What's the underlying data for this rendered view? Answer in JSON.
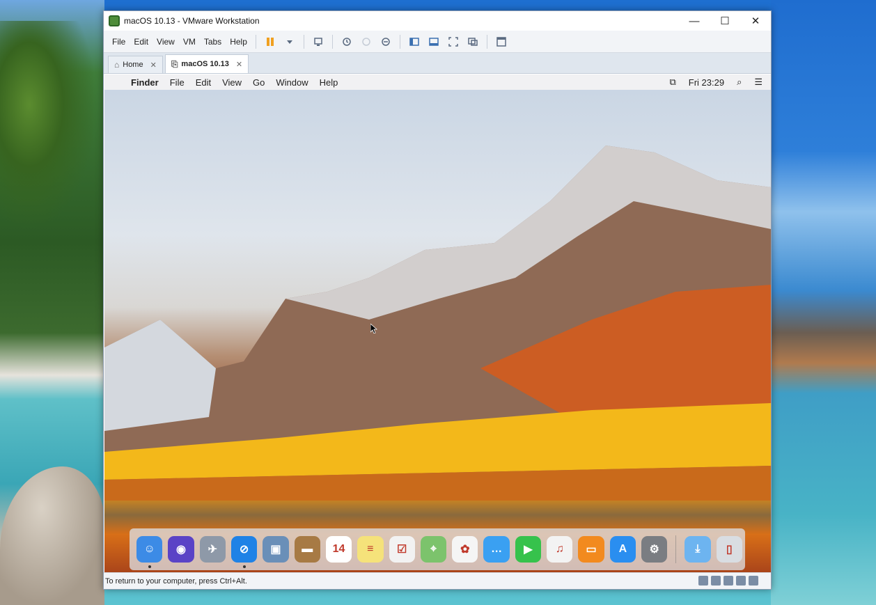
{
  "window": {
    "title": "macOS 10.13 - VMware Workstation",
    "minimize": "—",
    "maximize": "☐",
    "close": "✕"
  },
  "menubar": {
    "items": [
      "File",
      "Edit",
      "View",
      "VM",
      "Tabs",
      "Help"
    ]
  },
  "toolbar": {
    "buttons": [
      "pause-icon",
      "dropdown-icon",
      "send-ctrl-alt-del-icon",
      "snapshot-icon",
      "revert-snapshot-icon",
      "snapshot-manager-icon",
      "show-library-icon",
      "thumbnail-bar-icon",
      "full-screen-icon",
      "unity-icon",
      "console-view-icon"
    ]
  },
  "tabs": [
    {
      "label": "Home",
      "icon": "home-icon",
      "close": "✕"
    },
    {
      "label": "macOS 10.13",
      "icon": "vm-icon",
      "close": "✕",
      "active": true
    }
  ],
  "guest_menubar": {
    "apple": "",
    "items": [
      "Finder",
      "File",
      "Edit",
      "View",
      "Go",
      "Window",
      "Help"
    ],
    "clock": "Fri 23:29"
  },
  "dock": {
    "apps": [
      {
        "name": "finder",
        "color": "#3c8be6",
        "glyph": "☺",
        "running": true
      },
      {
        "name": "siri",
        "color": "#5a43c6",
        "glyph": "◉"
      },
      {
        "name": "launchpad",
        "color": "#8e99a8",
        "glyph": "✈"
      },
      {
        "name": "safari",
        "color": "#1f82e6",
        "glyph": "⊘",
        "running": true
      },
      {
        "name": "preview",
        "color": "#6a8fb8",
        "glyph": "▣"
      },
      {
        "name": "notefile",
        "color": "#a77a44",
        "glyph": "▬"
      },
      {
        "name": "calendar",
        "color": "#ffffff",
        "glyph": "14"
      },
      {
        "name": "notes",
        "color": "#f5e27a",
        "glyph": "≡"
      },
      {
        "name": "reminders",
        "color": "#f2f2f2",
        "glyph": "☑"
      },
      {
        "name": "maps",
        "color": "#7cc36c",
        "glyph": "⌖"
      },
      {
        "name": "photos",
        "color": "#f5f5f5",
        "glyph": "✿"
      },
      {
        "name": "messages",
        "color": "#3aa0f2",
        "glyph": "…"
      },
      {
        "name": "facetime",
        "color": "#36c24c",
        "glyph": "▶"
      },
      {
        "name": "itunes",
        "color": "#f3f3f3",
        "glyph": "♫"
      },
      {
        "name": "ibooks",
        "color": "#f28a1e",
        "glyph": "▭"
      },
      {
        "name": "app-store",
        "color": "#2a8ef0",
        "glyph": "A"
      },
      {
        "name": "system-preferences",
        "color": "#7a7d82",
        "glyph": "⚙"
      }
    ],
    "extras": [
      {
        "name": "downloads",
        "color": "#6db4f0",
        "glyph": "⤓"
      },
      {
        "name": "trash",
        "color": "#d9dde2",
        "glyph": "▯"
      }
    ]
  },
  "statusbar": {
    "message": "To return to your computer, press Ctrl+Alt."
  }
}
